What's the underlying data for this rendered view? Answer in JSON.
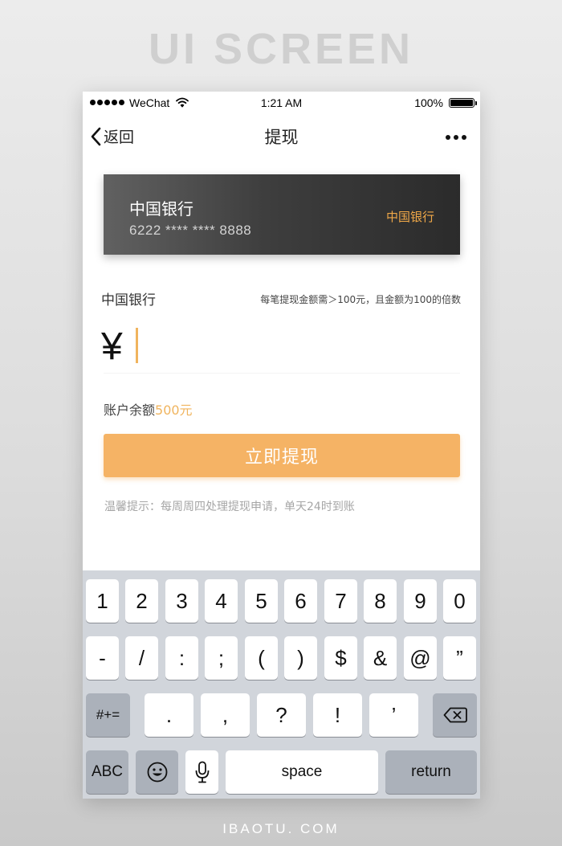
{
  "page": {
    "heading": "UI SCREEN",
    "footer": "IBAOTU. COM",
    "accent_color": "#f5b365",
    "icons": [
      "wifi-icon",
      "battery-icon",
      "back-chevron-icon",
      "more-dots-icon",
      "backspace-icon",
      "emoji-icon",
      "microphone-icon"
    ]
  },
  "status_bar": {
    "carrier": "WeChat",
    "time": "1:21 AM",
    "battery": "100%"
  },
  "nav": {
    "back_label": "返回",
    "title": "提现"
  },
  "card": {
    "name": "中国银行",
    "number": "6222 **** **** 8888",
    "brand": "中国银行"
  },
  "withdraw": {
    "bank_label": "中国银行",
    "rule_note": "每笔提现金额需＞100元，且金额为100的倍数",
    "currency_symbol": "¥",
    "amount_value": "",
    "balance_label": "账户余额",
    "balance_value": "500元",
    "submit_label": "立即提现",
    "tip": "温馨提示：每周周四处理提现申请，单天24时到账"
  },
  "keyboard": {
    "row1": [
      "1",
      "2",
      "3",
      "4",
      "5",
      "6",
      "7",
      "8",
      "9",
      "0"
    ],
    "row2": [
      "-",
      "/",
      ":",
      ";",
      "(",
      ")",
      "$",
      "&",
      "@",
      "”"
    ],
    "row3_mode": "#+=",
    "row3": [
      ".",
      ",",
      "?",
      "!",
      "’"
    ],
    "abc": "ABC",
    "space": "space",
    "return": "return"
  }
}
